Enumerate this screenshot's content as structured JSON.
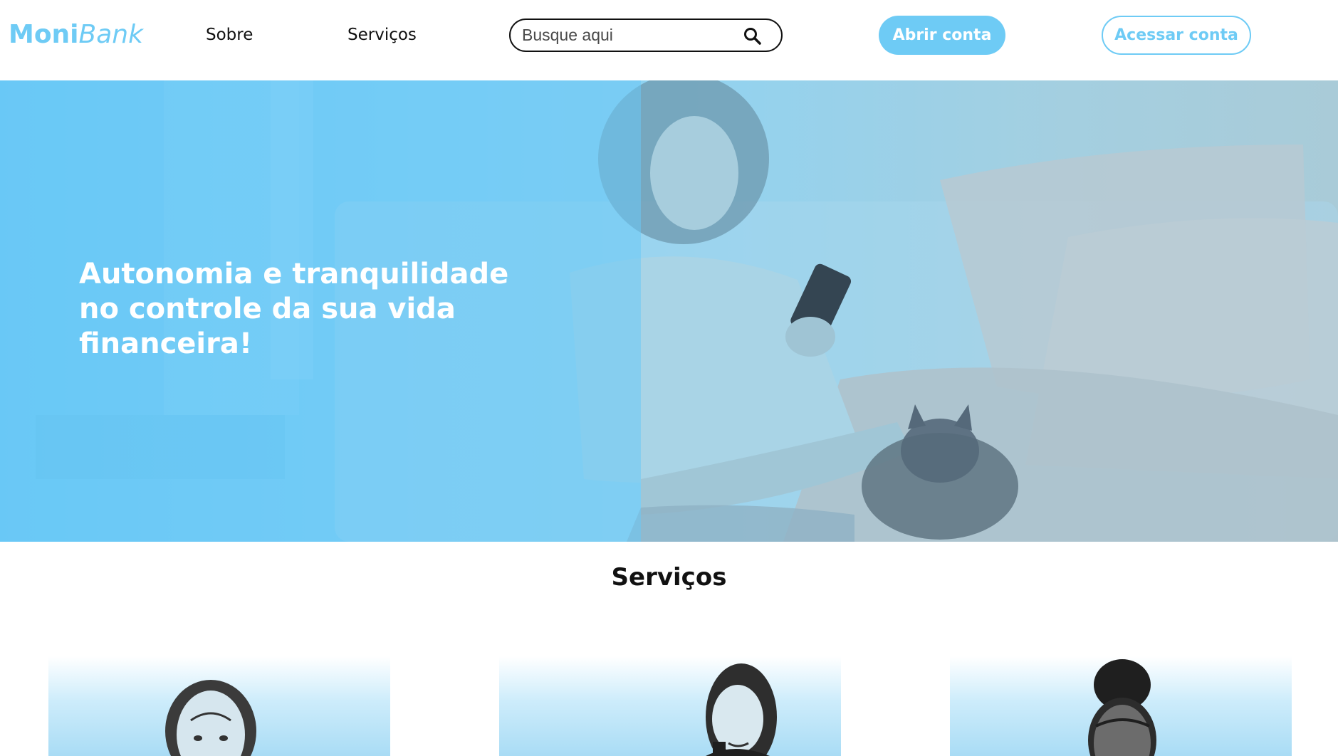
{
  "header": {
    "logo": {
      "primary": "Moni",
      "secondary": "Bank"
    },
    "nav": [
      {
        "label": "Sobre"
      },
      {
        "label": "Serviços"
      }
    ],
    "search": {
      "placeholder": "Busque aqui",
      "value": "",
      "icon": "search-icon"
    },
    "open_account_label": "Abrir conta",
    "access_account_label": "Acessar conta"
  },
  "hero": {
    "title": "Autonomia e tranquilidade no controle da sua vida financeira!"
  },
  "services": {
    "title": "Serviços"
  },
  "colors": {
    "brand": "#6ecbf5",
    "text": "#111111",
    "white": "#ffffff"
  }
}
